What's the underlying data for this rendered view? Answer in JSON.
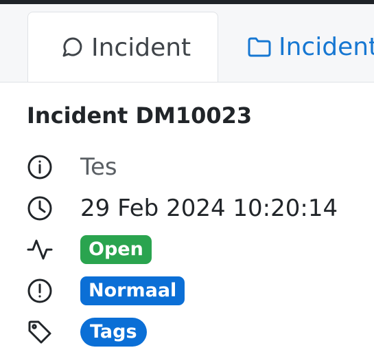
{
  "tabs": [
    {
      "label": "Incident",
      "icon": "chat-bubble-icon",
      "active": true
    },
    {
      "label": "Incident",
      "icon": "folder-icon",
      "active": false
    }
  ],
  "incident": {
    "title": "Incident DM10023",
    "description": "Tes",
    "datetime": "29 Feb 2024 10:20:14",
    "status": {
      "label": "Open",
      "color": "#2aa44f"
    },
    "priority": {
      "label": "Normaal",
      "color": "#0b6fd6"
    },
    "tags": {
      "label": "Tags",
      "color": "#0b6fd6"
    }
  },
  "colors": {
    "accent": "#1677d2",
    "tab_bar_bg": "#f6f7f9",
    "text": "#212529"
  }
}
